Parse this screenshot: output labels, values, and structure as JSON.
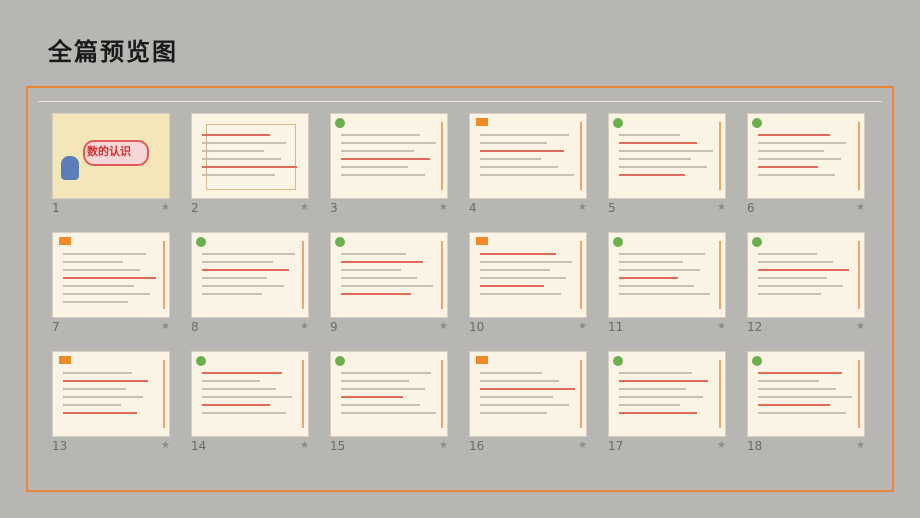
{
  "header": {
    "title": "全篇预览图"
  },
  "slides": [
    {
      "number": "1",
      "kind": "cover",
      "title": "数的认识"
    },
    {
      "number": "2",
      "kind": "toc"
    },
    {
      "number": "3",
      "kind": "content"
    },
    {
      "number": "4",
      "kind": "content"
    },
    {
      "number": "5",
      "kind": "content"
    },
    {
      "number": "6",
      "kind": "content"
    },
    {
      "number": "7",
      "kind": "table"
    },
    {
      "number": "8",
      "kind": "content"
    },
    {
      "number": "9",
      "kind": "content"
    },
    {
      "number": "10",
      "kind": "content"
    },
    {
      "number": "11",
      "kind": "content"
    },
    {
      "number": "12",
      "kind": "content"
    },
    {
      "number": "13",
      "kind": "content"
    },
    {
      "number": "14",
      "kind": "content"
    },
    {
      "number": "15",
      "kind": "content"
    },
    {
      "number": "16",
      "kind": "content"
    },
    {
      "number": "17",
      "kind": "content"
    },
    {
      "number": "18",
      "kind": "content"
    }
  ],
  "star_glyph": "★",
  "colors": {
    "frame": "#e8873a",
    "background": "#b8b6b3",
    "thumb_bg": "#fbf4e4"
  }
}
